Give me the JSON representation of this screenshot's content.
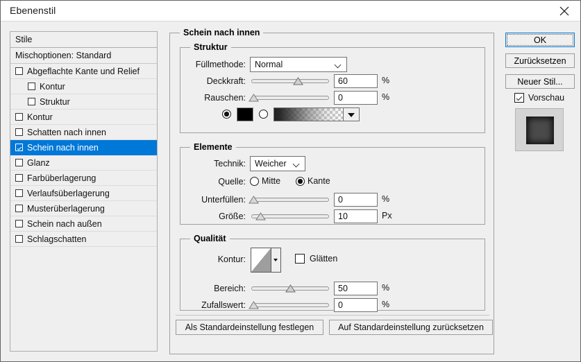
{
  "window": {
    "title": "Ebenenstil",
    "close_icon": "close-icon"
  },
  "sidebar": {
    "header": "Stile",
    "blending": "Mischoptionen: Standard",
    "items": [
      {
        "label": "Abgeflachte Kante und Relief",
        "checked": false,
        "indent": false,
        "selected": false
      },
      {
        "label": "Kontur",
        "checked": false,
        "indent": true,
        "selected": false
      },
      {
        "label": "Struktur",
        "checked": false,
        "indent": true,
        "selected": false
      },
      {
        "label": "Kontur",
        "checked": false,
        "indent": false,
        "selected": false
      },
      {
        "label": "Schatten nach innen",
        "checked": false,
        "indent": false,
        "selected": false
      },
      {
        "label": "Schein nach innen",
        "checked": true,
        "indent": false,
        "selected": true
      },
      {
        "label": "Glanz",
        "checked": false,
        "indent": false,
        "selected": false
      },
      {
        "label": "Farbüberlagerung",
        "checked": false,
        "indent": false,
        "selected": false
      },
      {
        "label": "Verlaufsüberlagerung",
        "checked": false,
        "indent": false,
        "selected": false
      },
      {
        "label": "Musterüberlagerung",
        "checked": false,
        "indent": false,
        "selected": false
      },
      {
        "label": "Schein nach außen",
        "checked": false,
        "indent": false,
        "selected": false
      },
      {
        "label": "Schlagschatten",
        "checked": false,
        "indent": false,
        "selected": false
      }
    ]
  },
  "main": {
    "group_title": "Schein nach innen",
    "struktur": {
      "title": "Struktur",
      "fillmethod_label": "Füllmethode:",
      "fillmethod_value": "Normal",
      "opacity_label": "Deckkraft:",
      "opacity_value": "60",
      "opacity_unit": "%",
      "noise_label": "Rauschen:",
      "noise_value": "0",
      "noise_unit": "%",
      "color_radio_selected": true,
      "color_swatch": "#000000",
      "gradient_radio_selected": false
    },
    "elemente": {
      "title": "Elemente",
      "technik_label": "Technik:",
      "technik_value": "Weicher",
      "quelle_label": "Quelle:",
      "quelle_mitte": "Mitte",
      "quelle_kante": "Kante",
      "quelle_selected": "Kante",
      "unterfuellen_label": "Unterfüllen:",
      "unterfuellen_value": "0",
      "unterfuellen_unit": "%",
      "groesse_label": "Größe:",
      "groesse_value": "10",
      "groesse_unit": "Px"
    },
    "qualitaet": {
      "title": "Qualität",
      "kontur_label": "Kontur:",
      "glaetten_label": "Glätten",
      "glaetten_checked": false,
      "bereich_label": "Bereich:",
      "bereich_value": "50",
      "bereich_unit": "%",
      "zufallswert_label": "Zufallswert:",
      "zufallswert_value": "0",
      "zufallswert_unit": "%"
    },
    "set_default_button": "Als Standardeinstellung festlegen",
    "reset_default_button": "Auf Standardeinstellung zurücksetzen"
  },
  "right": {
    "ok": "OK",
    "reset": "Zurücksetzen",
    "new_style": "Neuer Stil...",
    "preview_label": "Vorschau",
    "preview_checked": true,
    "accent_color": "#0078d7",
    "selection_color": "#0078d7"
  }
}
